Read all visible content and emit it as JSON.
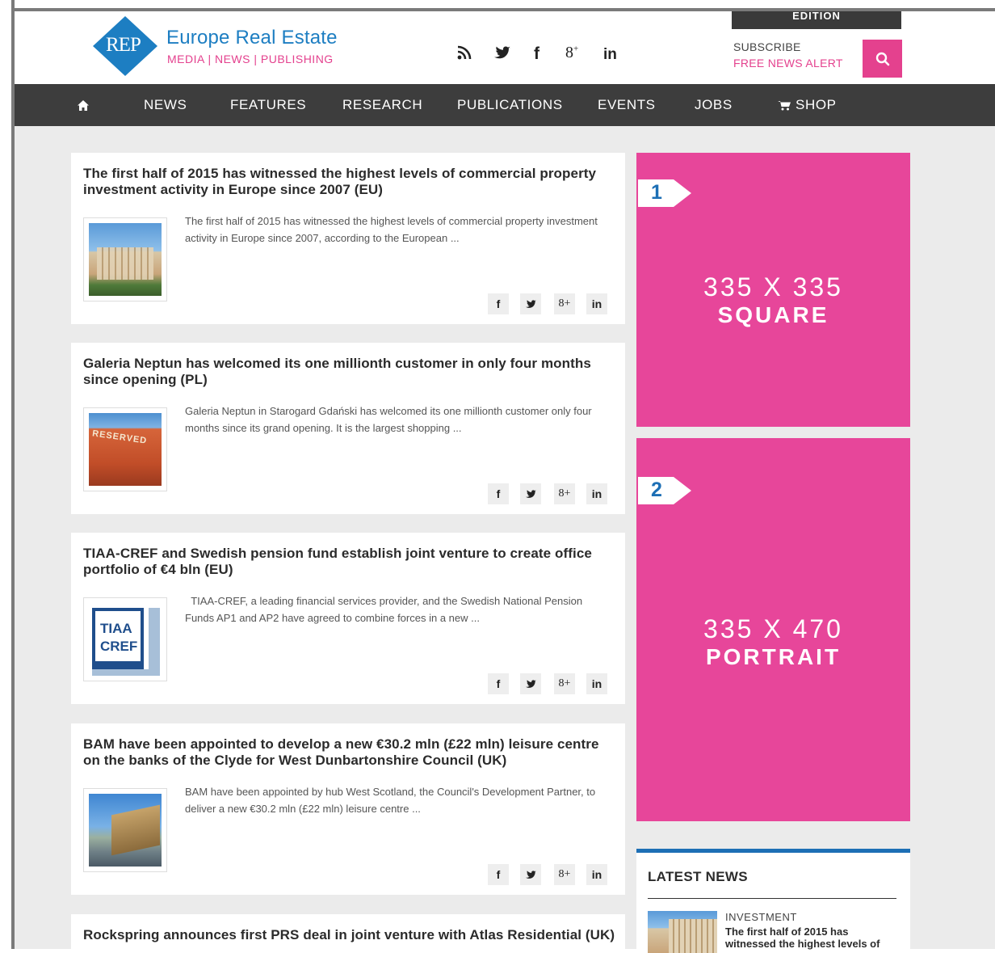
{
  "header": {
    "edition_label": "EDITION",
    "logo_badge": "REP",
    "logo_title": "Europe Real Estate",
    "logo_subtitle": "MEDIA | NEWS | PUBLISHING",
    "social_icons": [
      "rss-icon",
      "twitter-icon",
      "facebook-icon",
      "google-plus-icon",
      "linkedin-icon"
    ],
    "subscribe_label": "SUBSCRIBE",
    "subscribe_link": "FREE NEWS ALERT",
    "search_icon": "search-icon"
  },
  "nav": {
    "home_icon": "home-icon",
    "items": [
      "NEWS",
      "FEATURES",
      "RESEARCH",
      "PUBLICATIONS",
      "EVENTS",
      "JOBS",
      "SHOP"
    ],
    "shop_icon": "cart-icon"
  },
  "articles": [
    {
      "title": "The first half of 2015 has witnessed the highest levels of commercial property investment activity in Europe since 2007 (EU)",
      "excerpt": "The first half of 2015 has witnessed the highest levels of commercial property investment activity in Europe since 2007, according to the European ..."
    },
    {
      "title": "Galeria Neptun has welcomed its one millionth customer in only four months since opening (PL)",
      "excerpt": "Galeria Neptun in Starogard Gdański has welcomed its one millionth customer only four months since its grand opening. It is the largest shopping ...",
      "thumb_text": "RESERVED"
    },
    {
      "title": "TIAA-CREF and Swedish pension fund establish joint venture to create office portfolio of €4 bln (EU)",
      "excerpt": "  TIAA-CREF, a leading financial services provider, and the Swedish National Pension Funds AP1 and AP2 have agreed to combine forces in a new ...",
      "thumb_logo_line1": "TIAA",
      "thumb_logo_line2": "CREF"
    },
    {
      "title": "BAM have been appointed to develop a new €30.2 mln (£22 mln) leisure centre on the banks of the Clyde for West Dunbartonshire Council (UK)",
      "excerpt": "BAM have been appointed by hub West Scotland, the Council's Development Partner, to deliver a new €30.2 mln (£22 mln) leisure centre ..."
    },
    {
      "title": "Rockspring announces first PRS deal in joint venture with Atlas Residential (UK)"
    }
  ],
  "share_buttons": {
    "facebook": "f",
    "twitter": "🐦",
    "googleplus": "8+",
    "linkedin": "in"
  },
  "ads": [
    {
      "marker": "1",
      "size": "335 X 335",
      "kind": "SQUARE"
    },
    {
      "marker": "2",
      "size": "335 X 470",
      "kind": "PORTRAIT"
    }
  ],
  "latest_news": {
    "title": "LATEST NEWS",
    "item_category": "INVESTMENT",
    "item_headline": "The first half of 2015 has witnessed the highest levels of"
  },
  "colors": {
    "brand_blue": "#1d7ec2",
    "brand_pink": "#e4418e",
    "ad_pink": "#e7469a",
    "nav_dark": "#3d3d3d",
    "marker_blue": "#1d6fb5"
  }
}
